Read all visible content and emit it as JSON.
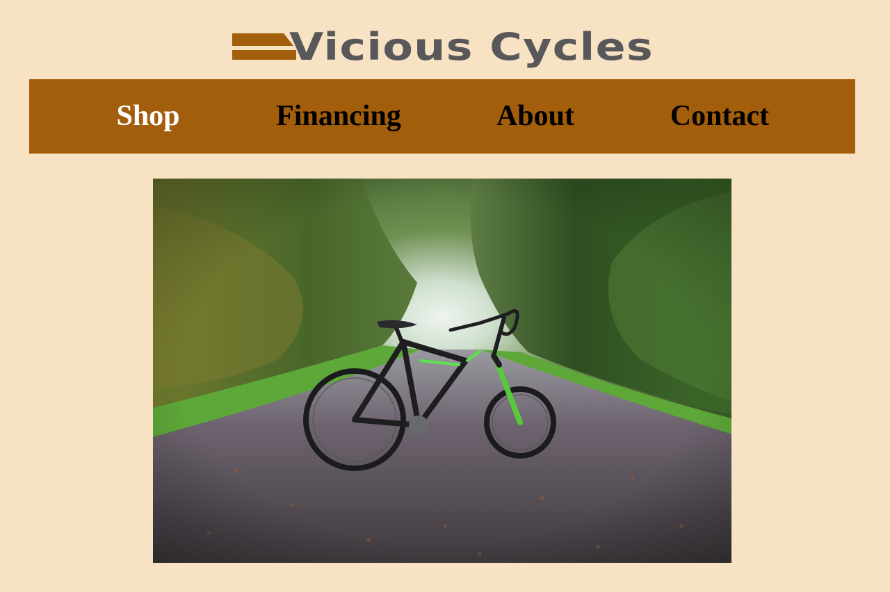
{
  "brand": {
    "name": "Vicious Cycles",
    "text_color": "#58585a",
    "accent_color": "#a35e0b"
  },
  "nav": {
    "background": "#a35e0b",
    "active_color": "#ffffff",
    "items": [
      {
        "label": "Shop",
        "active": true
      },
      {
        "label": "Financing",
        "active": false
      },
      {
        "label": "About",
        "active": false
      },
      {
        "label": "Contact",
        "active": false
      }
    ]
  },
  "hero": {
    "icon": "mountain-bike-photo"
  },
  "page": {
    "background": "#f8e2c4"
  }
}
